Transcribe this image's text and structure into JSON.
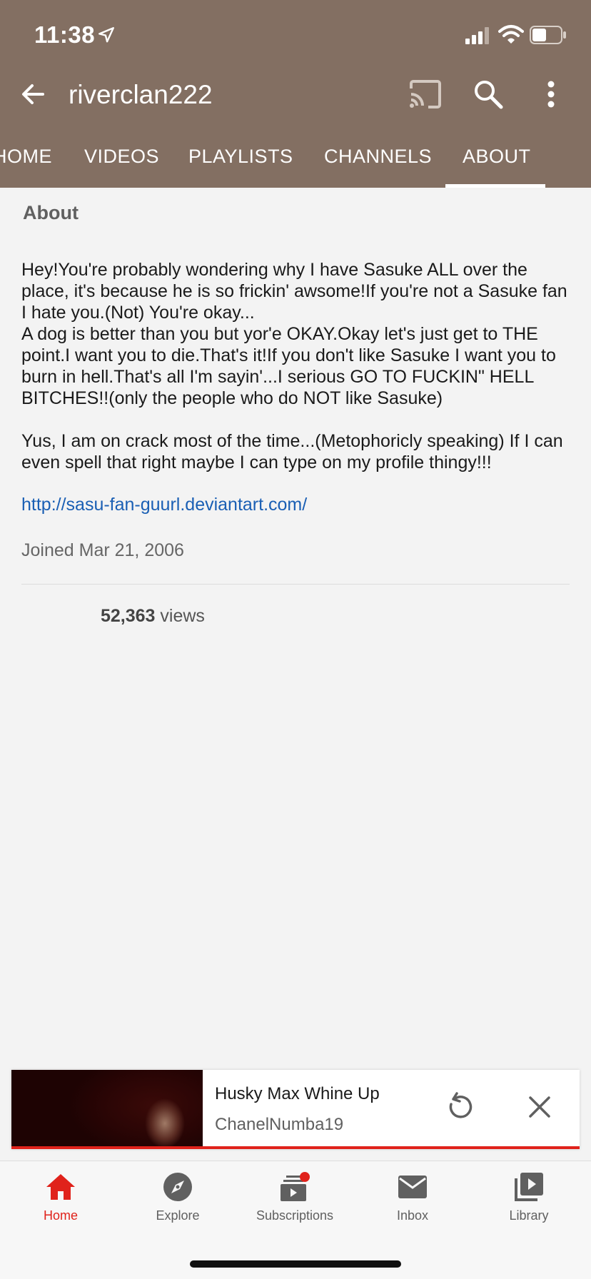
{
  "status": {
    "time": "11:38"
  },
  "appbar": {
    "title": "riverclan222"
  },
  "tabs": [
    "HOME",
    "VIDEOS",
    "PLAYLISTS",
    "CHANNELS",
    "ABOUT"
  ],
  "about": {
    "heading": "About",
    "description": "Hey!You're probably wondering why I have Sasuke ALL over the place, it's because he is so frickin' awsome!If you're not a Sasuke fan I hate you.(Not) You're okay...\nA dog is better than you but yor'e OKAY.Okay let's just get to THE point.I want you to die.That's it!If you don't like Sasuke I want you to burn in hell.That's all I'm sayin'...I serious GO TO FUCKIN\" HELL BITCHES!!(only the people who do NOT like Sasuke)\n\nYus, I am on crack most of the time...(Metophoricly speaking) If I can even spell that right maybe I can type on my profile thingy!!!",
    "link": "http://sasu-fan-guurl.deviantart.com/",
    "joined": "Joined Mar 21, 2006",
    "views_count": "52,363",
    "views_suffix": " views"
  },
  "miniplayer": {
    "title": "Husky Max Whine Up",
    "channel": "ChanelNumba19"
  },
  "bottomnav": [
    {
      "label": "Home",
      "icon": "home-icon"
    },
    {
      "label": "Explore",
      "icon": "explore-icon"
    },
    {
      "label": "Subscriptions",
      "icon": "subscriptions-icon"
    },
    {
      "label": "Inbox",
      "icon": "inbox-icon"
    },
    {
      "label": "Library",
      "icon": "library-icon"
    }
  ],
  "colors": {
    "topbar": "#836f62",
    "accent": "#e0221b",
    "link": "#1a5fb4"
  }
}
